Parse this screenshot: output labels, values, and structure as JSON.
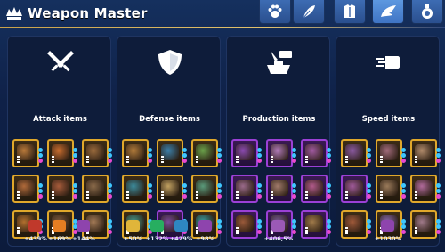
{
  "window": {
    "title": "Weapon Master"
  },
  "icons": {
    "logo": "crown-wing-icon"
  },
  "tabs": [
    {
      "name": "paw-icon",
      "active": false
    },
    {
      "name": "feather-icon",
      "active": false
    },
    {
      "name": "armor-icon",
      "active": false
    },
    {
      "name": "wing-icon",
      "active": true
    },
    {
      "name": "potion-icon",
      "active": false
    }
  ],
  "panels": [
    {
      "title": "Attack items",
      "icon": "crossed-swords-icon",
      "frame": "gold",
      "items": [
        [
          "#b8793a",
          "#c76c2e",
          "#9a6a3c"
        ],
        [
          "#b06a3a",
          "#a55b3a",
          "#8a6a4a"
        ],
        [
          "#b2702e",
          "#7e5a3c",
          "#a37a56"
        ]
      ],
      "bonuses": [
        {
          "icon": "sword-icon",
          "color": "#c0392b",
          "value": "+439%"
        },
        {
          "icon": "flame-icon",
          "color": "#e67e22",
          "value": "+169%"
        },
        {
          "icon": "claw-icon",
          "color": "#8e44ad",
          "value": "+144%"
        }
      ]
    },
    {
      "title": "Defense items",
      "icon": "shield-icon",
      "frame": "gold",
      "items": [
        [
          "#b07a3a",
          "#3c7fa8",
          "#6aa04a"
        ],
        [
          "#3c8a9a",
          "#c0a060",
          "#5a9a7a"
        ],
        [
          "#4a9a8a",
          "#7a4a9a",
          "#3aa0a0"
        ]
      ],
      "bonuses": [
        {
          "icon": "crown-icon",
          "color": "#e0b53a",
          "value": "+50%"
        },
        {
          "icon": "chat-icon",
          "color": "#27ae60",
          "value": "+132%"
        },
        {
          "icon": "shield-small-icon",
          "color": "#2e86c1",
          "value": "+429%"
        },
        {
          "icon": "wing-small-icon",
          "color": "#8e44ad",
          "value": "+98%"
        }
      ]
    },
    {
      "title": "Production items",
      "icon": "production-icon",
      "frame": "purple",
      "items": [
        [
          "#8a4ab0",
          "#b07ab8",
          "#a05aa0"
        ],
        [
          "#9a6a8a",
          "#a07a6a",
          "#b05a8a"
        ],
        [
          "#9a5a3a",
          "#7a5a9a",
          "#a07a4a"
        ]
      ],
      "bonuses": [
        {
          "icon": "chest-icon",
          "color": "#9b59b6",
          "value": "+406,5%"
        }
      ]
    },
    {
      "title": "Speed items",
      "icon": "speed-icon",
      "frame": "gold",
      "items": [
        [
          "#8a5aa0",
          "#a06a7a",
          "#b08a6a"
        ],
        [
          "#a05a9a",
          "#9a7a5a",
          "#b06a9a"
        ],
        [
          "#a05a3a",
          "#8a6ab0",
          "#a07a8a"
        ]
      ],
      "bonuses": [
        {
          "icon": "dash-icon",
          "color": "#8e44ad",
          "value": "+1030%"
        }
      ]
    }
  ]
}
